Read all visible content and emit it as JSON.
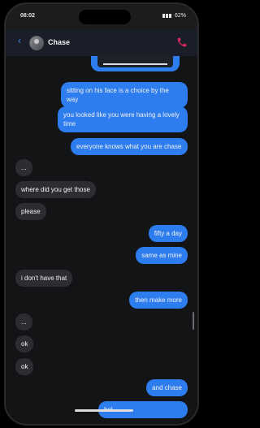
{
  "status": {
    "time": "08:02",
    "battery": "62%"
  },
  "header": {
    "contact_name": "Chase"
  },
  "messages": [
    {
      "dir": "out",
      "text": "sitting on his face is a choice by the way"
    },
    {
      "dir": "out",
      "text": "you looked like you were having a lovely time"
    },
    {
      "dir": "out",
      "text": "everyone knows what you are chase"
    },
    {
      "dir": "in",
      "text": "..."
    },
    {
      "dir": "in",
      "text": "where did you get those"
    },
    {
      "dir": "in",
      "text": "please"
    },
    {
      "dir": "out",
      "text": "fifty a day"
    },
    {
      "dir": "out",
      "text": "same as mine"
    },
    {
      "dir": "in",
      "text": "i don't have that"
    },
    {
      "dir": "out",
      "text": "then make more"
    },
    {
      "dir": "in",
      "text": "..."
    },
    {
      "dir": "in",
      "text": "ok"
    },
    {
      "dir": "in",
      "text": "ok"
    },
    {
      "dir": "out",
      "text": "and chase"
    },
    {
      "dir": "out",
      "text": "bel"
    }
  ],
  "colors": {
    "outgoing": "#2e7dee",
    "incoming": "#2b2d33",
    "call_icon": "#e0245e",
    "back_icon": "#3d8be6"
  }
}
